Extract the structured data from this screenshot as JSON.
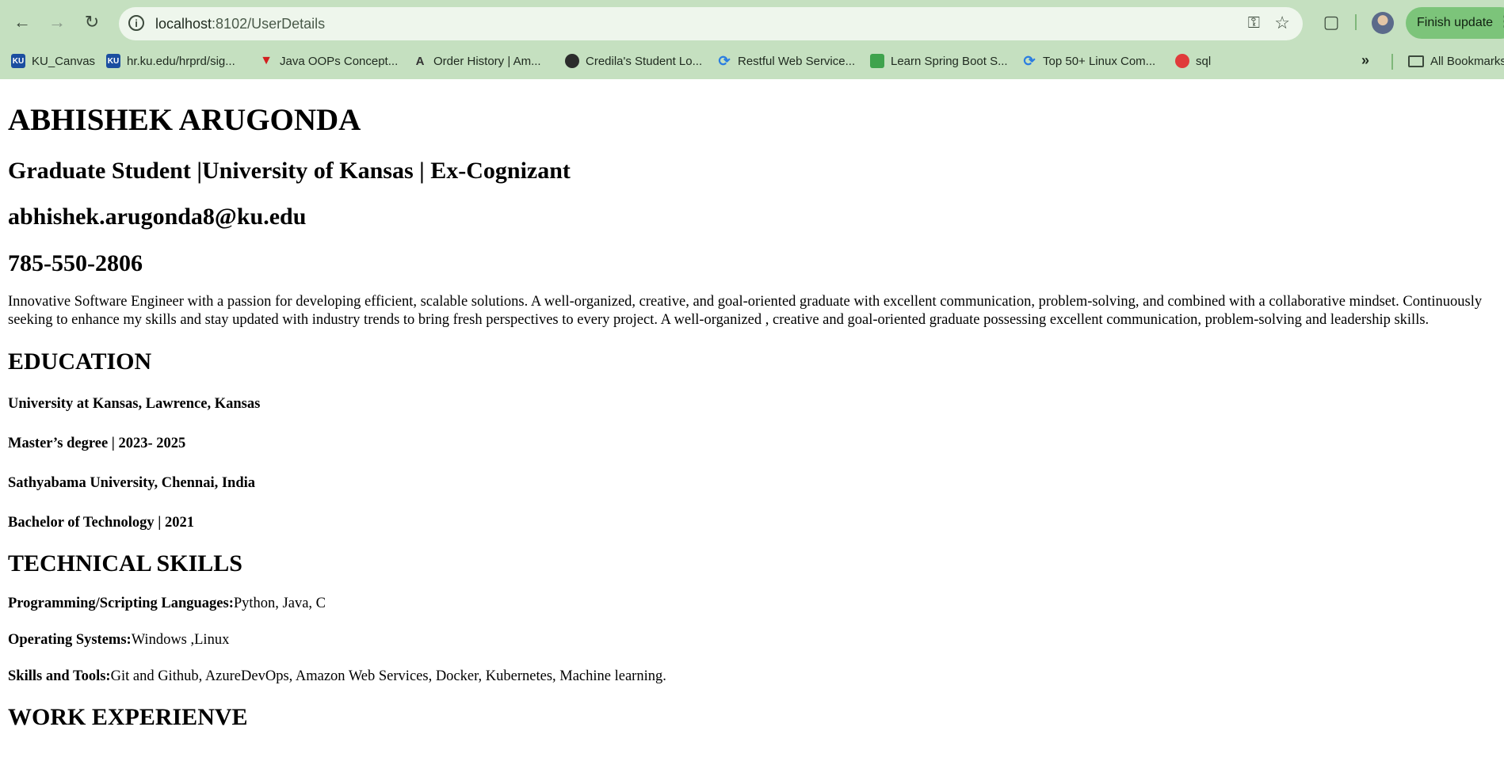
{
  "browser": {
    "url_host": "localhost",
    "url_rest": ":8102/UserDetails",
    "finish_update_label": "Finish update",
    "bookmarks": [
      {
        "label": "KU_Canvas",
        "icon": "ku-logo-icon"
      },
      {
        "label": "hr.ku.edu/hrprd/sig...",
        "icon": "ku-logo-icon"
      },
      {
        "label": "Java OOPs Concept...",
        "icon": "red-triangle-icon"
      },
      {
        "label": "Order History | Am...",
        "icon": "amazon-icon"
      },
      {
        "label": "Credila's Student Lo...",
        "icon": "globe-icon"
      },
      {
        "label": "Restful Web Service...",
        "icon": "swirl-icon"
      },
      {
        "label": "Learn Spring Boot S...",
        "icon": "leaf-icon"
      },
      {
        "label": "Top 50+ Linux Com...",
        "icon": "swirl-icon"
      },
      {
        "label": "sql",
        "icon": "sql-icon"
      }
    ],
    "all_bookmarks_label": "All Bookmarks"
  },
  "profile": {
    "name": "ABHISHEK ARUGONDA",
    "headline": "Graduate Student |University of Kansas | Ex-Cognizant",
    "email": "abhishek.arugonda8@ku.edu",
    "phone": "785-550-2806",
    "summary": "Innovative Software Engineer with a passion for developing efficient, scalable solutions. A well-organized, creative, and goal-oriented graduate with excellent communication, problem-solving, and combined with a collaborative mindset. Continuously seeking to enhance my skills and stay updated with industry trends to bring fresh perspectives to every project. A well-organized , creative and goal-oriented graduate possessing excellent communication, problem-solving and leadership skills."
  },
  "education": {
    "heading": "EDUCATION",
    "lines": [
      "University at Kansas, Lawrence, Kansas",
      "Master’s degree | 2023- 2025",
      "Sathyabama University, Chennai, India",
      "Bachelor of Technology | 2021"
    ]
  },
  "skills": {
    "heading": "TECHNICAL SKILLS",
    "items": [
      {
        "label": "Programming/Scripting Languages:",
        "value": "Python, Java, C"
      },
      {
        "label": "Operating Systems:",
        "value": "Windows ,Linux"
      },
      {
        "label": "Skills and Tools:",
        "value": "Git and Github, AzureDevOps, Amazon Web Services, Docker, Kubernetes, Machine learning."
      }
    ]
  },
  "work": {
    "heading": "WORK EXPERIENVE"
  }
}
